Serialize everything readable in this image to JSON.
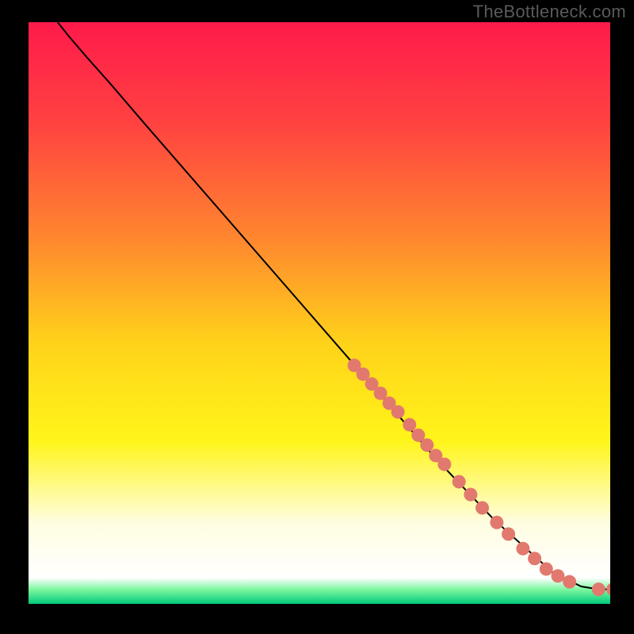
{
  "watermark": "TheBottleneck.com",
  "chart_data": {
    "type": "line",
    "title": "",
    "xlabel": "",
    "ylabel": "",
    "xlim": [
      0,
      100
    ],
    "ylim": [
      0,
      100
    ],
    "gradient_stops": [
      {
        "offset": 0.0,
        "color": "#ff1a4b"
      },
      {
        "offset": 0.18,
        "color": "#ff4440"
      },
      {
        "offset": 0.38,
        "color": "#ff8a2e"
      },
      {
        "offset": 0.55,
        "color": "#ffd21a"
      },
      {
        "offset": 0.72,
        "color": "#fff51a"
      },
      {
        "offset": 0.86,
        "color": "#fffde0"
      },
      {
        "offset": 0.955,
        "color": "#ffffff"
      },
      {
        "offset": 0.975,
        "color": "#7ef7a0"
      },
      {
        "offset": 1.0,
        "color": "#00c97a"
      }
    ],
    "curve": [
      {
        "x": 5.0,
        "y": 100.0
      },
      {
        "x": 7.0,
        "y": 97.5
      },
      {
        "x": 10.0,
        "y": 94.0
      },
      {
        "x": 14.0,
        "y": 89.5
      },
      {
        "x": 20.0,
        "y": 82.5
      },
      {
        "x": 30.0,
        "y": 71.0
      },
      {
        "x": 40.0,
        "y": 59.5
      },
      {
        "x": 50.0,
        "y": 48.0
      },
      {
        "x": 60.0,
        "y": 36.5
      },
      {
        "x": 70.0,
        "y": 25.0
      },
      {
        "x": 80.0,
        "y": 14.5
      },
      {
        "x": 90.0,
        "y": 5.5
      },
      {
        "x": 95.0,
        "y": 3.0
      },
      {
        "x": 98.0,
        "y": 2.5
      },
      {
        "x": 100.0,
        "y": 2.5
      }
    ],
    "markers": [
      {
        "x": 56.0,
        "y": 41.0
      },
      {
        "x": 57.5,
        "y": 39.5
      },
      {
        "x": 59.0,
        "y": 37.8
      },
      {
        "x": 60.5,
        "y": 36.2
      },
      {
        "x": 62.0,
        "y": 34.5
      },
      {
        "x": 63.5,
        "y": 33.0
      },
      {
        "x": 65.5,
        "y": 30.8
      },
      {
        "x": 67.0,
        "y": 29.0
      },
      {
        "x": 68.5,
        "y": 27.3
      },
      {
        "x": 70.0,
        "y": 25.5
      },
      {
        "x": 71.5,
        "y": 24.0
      },
      {
        "x": 74.0,
        "y": 21.0
      },
      {
        "x": 76.0,
        "y": 18.8
      },
      {
        "x": 78.0,
        "y": 16.5
      },
      {
        "x": 80.5,
        "y": 14.0
      },
      {
        "x": 82.5,
        "y": 12.0
      },
      {
        "x": 85.0,
        "y": 9.5
      },
      {
        "x": 87.0,
        "y": 7.8
      },
      {
        "x": 89.0,
        "y": 6.0
      },
      {
        "x": 91.0,
        "y": 4.8
      },
      {
        "x": 93.0,
        "y": 3.8
      },
      {
        "x": 98.0,
        "y": 2.5
      },
      {
        "x": 100.5,
        "y": 2.5
      }
    ],
    "marker_color": "#e2796e",
    "marker_radius": 8.5,
    "line_color": "#000000"
  }
}
